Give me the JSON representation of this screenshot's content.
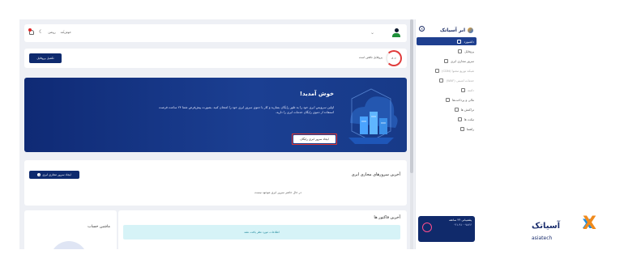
{
  "sidebar": {
    "brand": "ابر آسیاتک",
    "items": [
      {
        "label": "داشبورد",
        "icon": "home-icon",
        "active": true
      },
      {
        "label": "پروفایل",
        "icon": "user-icon"
      },
      {
        "label": "سرور مجازی ابری",
        "icon": "server-icon"
      },
      {
        "label": "شبکه توزیع محتوا (CDN)",
        "icon": "cdn-icon",
        "dim": true
      },
      {
        "label": "خدمات امنیتی (WAF)",
        "icon": "shield-icon",
        "dim": true
      },
      {
        "label": "دامنه",
        "icon": "globe-icon",
        "dim": true
      },
      {
        "label": "مالی و پرداخت‌ها",
        "icon": "wallet-icon"
      },
      {
        "label": "تراکنش ها",
        "icon": "transaction-icon"
      },
      {
        "label": "تیکت ها",
        "icon": "ticket-icon"
      },
      {
        "label": "راهنما",
        "icon": "help-icon"
      }
    ],
    "promo": {
      "title": "پشتیبانی ۲۴ ساعته",
      "phone": "۰۲۱-۹۱۰۰۷۸۶۶"
    }
  },
  "topbar": {
    "theme_label": "روشن",
    "lang_label": "خوش‌آمد"
  },
  "profile_card": {
    "progress": "۸۰٪",
    "status_text": "پروفایل ناقص است",
    "complete_button": "تکمیل پروفایل"
  },
  "hero": {
    "title": "خوش آمدید!",
    "description": "اولین سرویس ابری خود را به طور رایگان بسازید و کار با دموی سرور ابری خود را امتحان کنید. بصورت پیش‌فرض شما ۲۴ ساعت فرصت استفاده از دموی رایگان خدمات ابری را دارید.",
    "button": "ایجاد سرور ابری رایگان"
  },
  "servers_card": {
    "title": "آخرین سرورهای مجازی ابری",
    "create_button": "ایجاد سرور مجازی ابری",
    "empty_text": "در حال حاضر سرور ابری موجود نیست"
  },
  "calc_card": {
    "title": "ماشین حساب"
  },
  "invoices_card": {
    "title": "آخرین فاکتور ها",
    "empty_text": "اطلاعات مورد نظر یافت نشد"
  },
  "watermark": {
    "word": "آسیاتک",
    "sub": "asiatech"
  },
  "colors": {
    "primary": "#0e2a6e",
    "hero": "#1b3f92",
    "highlight": "#e3342f",
    "alert_bg": "#d6f3f7"
  }
}
